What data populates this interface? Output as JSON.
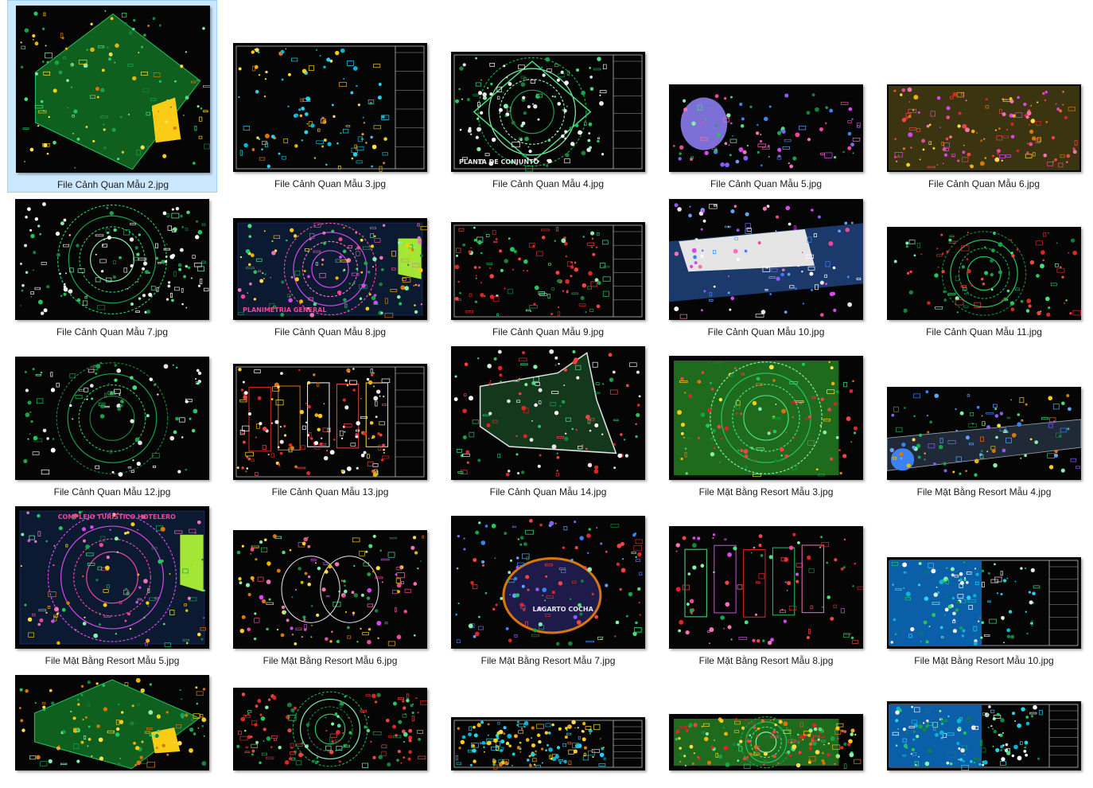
{
  "files": [
    {
      "name": "File Cảnh Quan Mẫu 2.jpg",
      "theme": "green-diagonal",
      "selected": true
    },
    {
      "name": "File Cảnh Quan Mẫu 3.jpg",
      "theme": "sheet-yellow"
    },
    {
      "name": "File Cảnh Quan Mẫu 4.jpg",
      "theme": "green-diamond",
      "thumb_text": "PLANTA DE CONJUNTO"
    },
    {
      "name": "File Cảnh Quan Mẫu 5.jpg",
      "theme": "lake-multicolor"
    },
    {
      "name": "File Cảnh Quan Mẫu 6.jpg",
      "theme": "dense-yellow"
    },
    {
      "name": "File Cảnh Quan Mẫu 7.jpg",
      "theme": "square-circular"
    },
    {
      "name": "File Cảnh Quan Mẫu 8.jpg",
      "theme": "arc-magenta",
      "thumb_text": "PLANIMETRIA GENERAL"
    },
    {
      "name": "File Cảnh Quan Mẫu 9.jpg",
      "theme": "park-sheet"
    },
    {
      "name": "File Cảnh Quan Mẫu 10.jpg",
      "theme": "river-white"
    },
    {
      "name": "File Cảnh Quan Mẫu 11.jpg",
      "theme": "dense-green"
    },
    {
      "name": "File Cảnh Quan Mẫu 12.jpg",
      "theme": "crescent"
    },
    {
      "name": "File Cảnh Quan Mẫu 13.jpg",
      "theme": "building-blocks"
    },
    {
      "name": "File Cảnh Quan Mẫu 14.jpg",
      "theme": "irregular-site"
    },
    {
      "name": "File Mặt Bằng Resort Mẫu 3.jpg",
      "theme": "fan-resort"
    },
    {
      "name": "File Mặt Bằng Resort Mẫu 4.jpg",
      "theme": "strip-resort"
    },
    {
      "name": "File Mặt Bằng Resort Mẫu 5.jpg",
      "theme": "arc-magenta-2",
      "thumb_text": "COMPLEJO TURISTICO HOTELERO"
    },
    {
      "name": "File Mặt Bằng Resort Mẫu 6.jpg",
      "theme": "butterfly"
    },
    {
      "name": "File Mặt Bằng Resort Mẫu 7.jpg",
      "theme": "lagoon",
      "thumb_text": "LAGARTO COCHA"
    },
    {
      "name": "File Mặt Bằng Resort Mẫu 8.jpg",
      "theme": "courtyard"
    },
    {
      "name": "File Mặt Bằng Resort Mẫu 10.jpg",
      "theme": "blue-sheet"
    },
    {
      "name": "",
      "theme": "green-diagonal"
    },
    {
      "name": "",
      "theme": "dense-green"
    },
    {
      "name": "",
      "theme": "sheet-yellow"
    },
    {
      "name": "",
      "theme": "fan-resort"
    },
    {
      "name": "",
      "theme": "blue-sheet"
    }
  ],
  "colors": {
    "selection_bg": "#cce8ff",
    "selection_border": "#99d1ff",
    "cad_background": "#050505"
  }
}
